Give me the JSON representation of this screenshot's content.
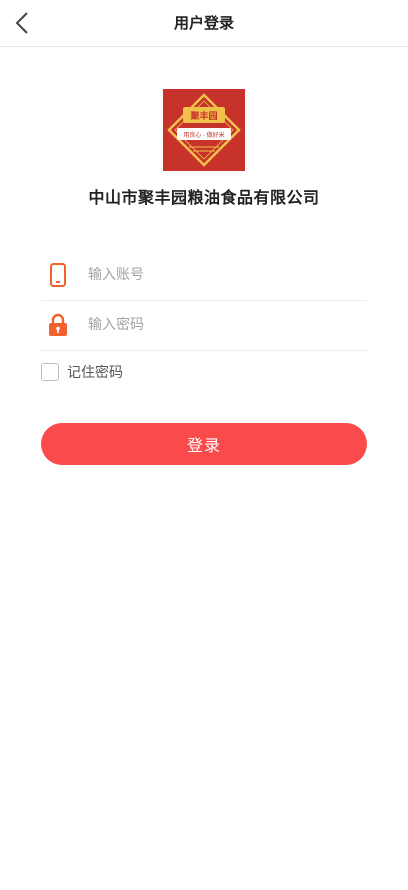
{
  "header": {
    "title": "用户登录",
    "back_icon": "chevron-left-icon"
  },
  "brand": {
    "logo_icon": "company-logo",
    "logo_text": "聚丰园",
    "logo_slogan": "用良心 · 做好米",
    "company_name": "中山市聚丰园粮油食品有限公司"
  },
  "form": {
    "account": {
      "icon": "phone-icon",
      "placeholder": "输入账号",
      "value": ""
    },
    "password": {
      "icon": "lock-icon",
      "placeholder": "输入密码",
      "value": ""
    },
    "remember": {
      "label": "记住密码",
      "checked": false
    },
    "login_label": "登录"
  },
  "colors": {
    "accent": "#fa4a4c",
    "icon_orange": "#f2602d",
    "logo_red": "#c7322a",
    "logo_gold": "#f0c24b"
  }
}
